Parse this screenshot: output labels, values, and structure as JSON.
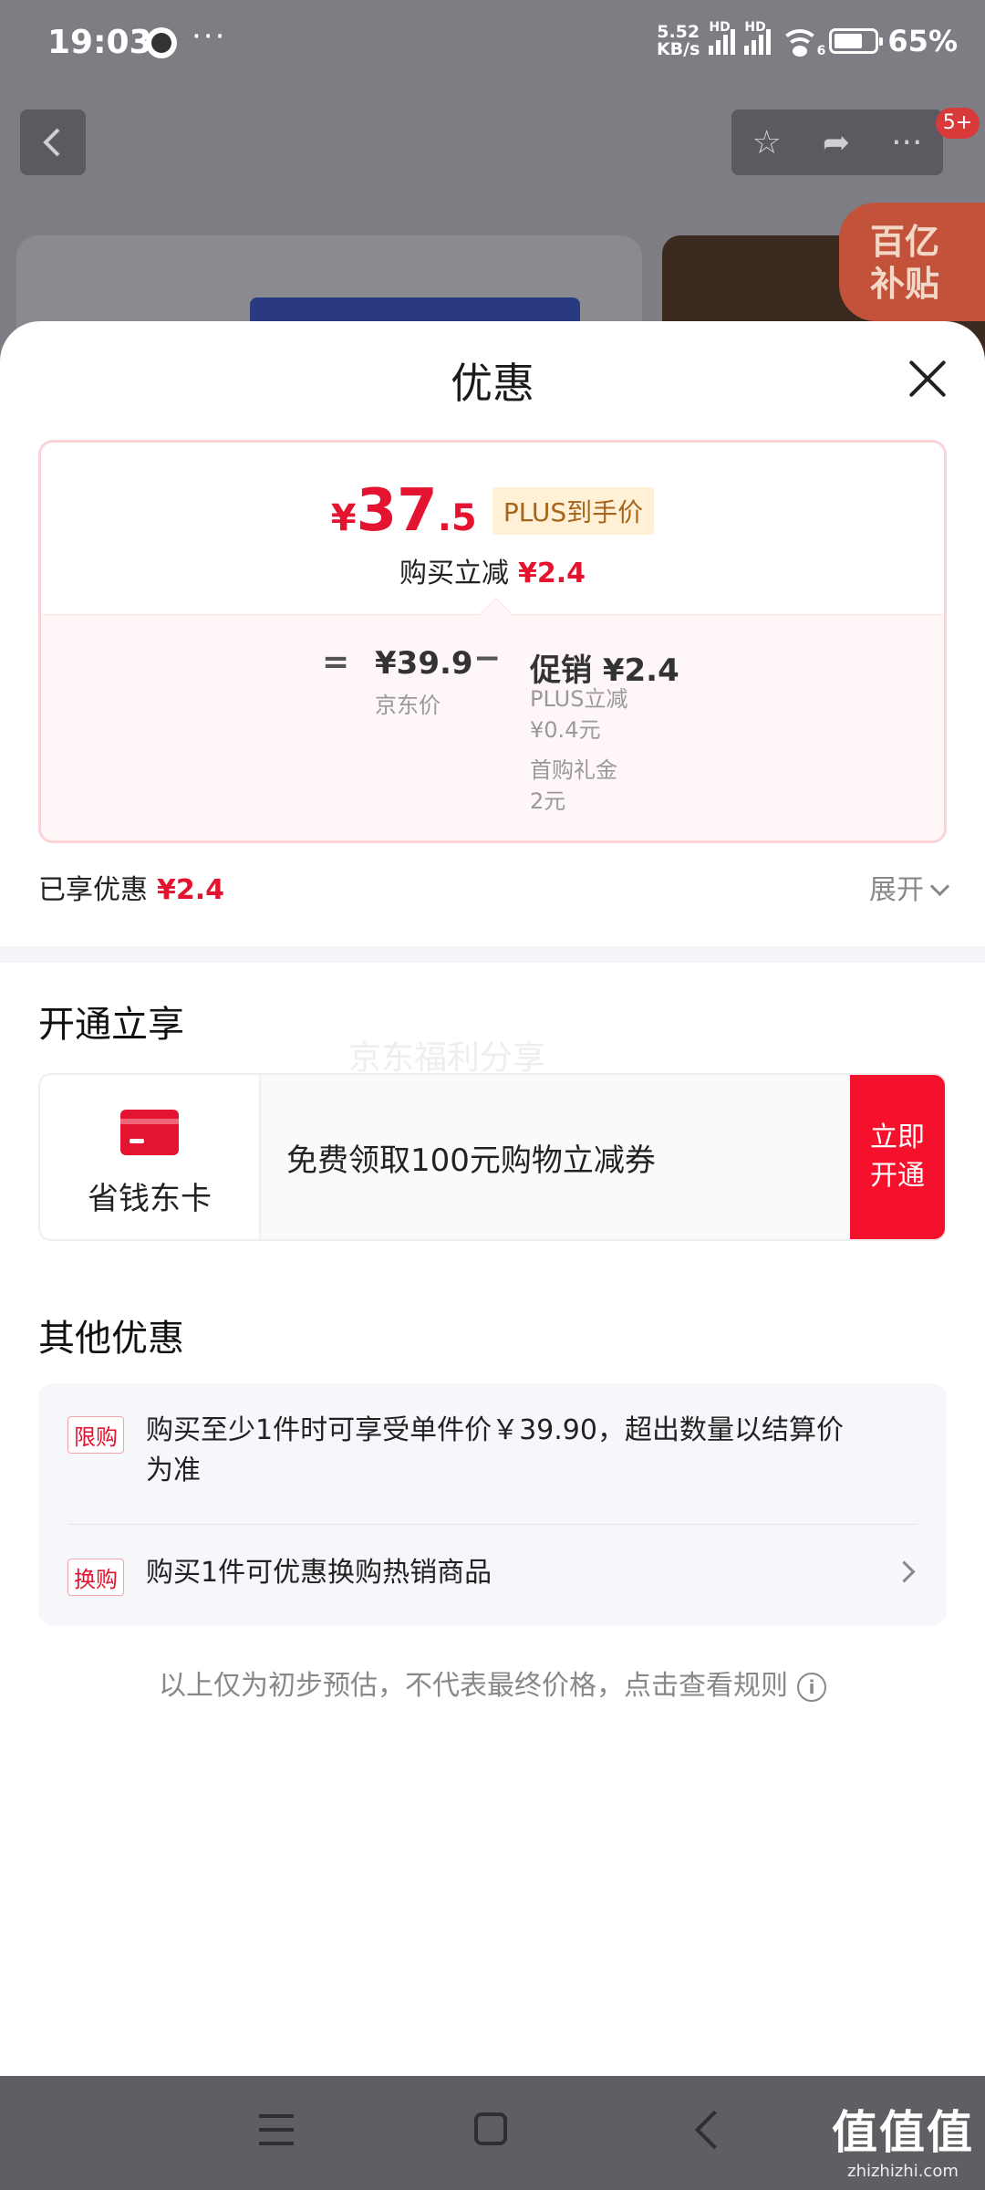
{
  "status_bar": {
    "time": "19:03",
    "more": "···",
    "net_speed_value": "5.52",
    "net_speed_unit": "KB/s",
    "hd_label": "HD",
    "wifi_badge": "6",
    "battery": "65%"
  },
  "background": {
    "badge": "5+",
    "subsidy_line1": "百亿",
    "subsidy_line2": "补贴"
  },
  "sheet": {
    "title": "优惠",
    "price": {
      "currency": "¥",
      "integer": "37",
      "decimal": ".5",
      "plus_tag": "PLUS到手价",
      "instant_label": "购买立减",
      "instant_value": "¥2.4"
    },
    "breakdown": {
      "equals": "=",
      "minus": "−",
      "jd_price": "¥39.9",
      "jd_label": "京东价",
      "promo_title": "促销 ¥2.4",
      "promo_details": [
        "PLUS立减",
        "¥0.4元",
        "首购礼金",
        "2元"
      ]
    },
    "enjoyed_label": "已享优惠",
    "enjoyed_value": "¥2.4",
    "expand_label": "展开",
    "open_section": {
      "title": "开通立享",
      "watermark": "京东福利分享",
      "card_name": "省钱东卡",
      "card_desc": "免费领取100元购物立减券",
      "card_button": "立即开通"
    },
    "other_section": {
      "title": "其他优惠",
      "rows": [
        {
          "tag": "限购",
          "text_line1": "购买至少1件时可享受单件价￥39.90，超出数量以结算价",
          "text_line2": "为准"
        },
        {
          "tag": "换购",
          "text_line1": "购买1件可优惠换购热销商品"
        }
      ]
    },
    "disclaimer": "以上仅为初步预估，不代表最终价格，点击查看规则",
    "info_glyph": "i"
  },
  "nav": {
    "logo_text": "值值值",
    "logo_sub": "zhizhizhi.com"
  }
}
